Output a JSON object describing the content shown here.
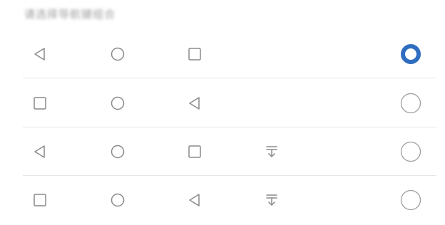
{
  "header": {
    "title": "请选择导航键组合"
  },
  "colors": {
    "accent": "#2f6dc0",
    "icon_stroke": "#8a8a8a",
    "radio_stroke": "#9e9e9e",
    "divider": "#e6e6e6"
  },
  "options": [
    {
      "keys": [
        "back-icon",
        "home-icon",
        "recents-icon"
      ],
      "selected": true
    },
    {
      "keys": [
        "recents-icon",
        "home-icon",
        "back-icon"
      ],
      "selected": false
    },
    {
      "keys": [
        "back-icon",
        "home-icon",
        "recents-icon",
        "notification-pull-down-icon"
      ],
      "selected": false
    },
    {
      "keys": [
        "recents-icon",
        "home-icon",
        "back-icon",
        "notification-pull-down-icon"
      ],
      "selected": false
    }
  ]
}
